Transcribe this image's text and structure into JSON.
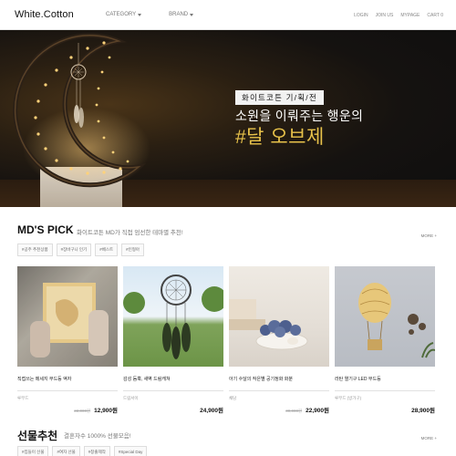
{
  "header": {
    "logo": "White.Cotton",
    "nav": [
      {
        "label": "CATEGORY"
      },
      {
        "label": "BRAND"
      }
    ],
    "user_links": [
      "LOGIN",
      "JOIN US",
      "MYPAGE",
      "CART 0"
    ]
  },
  "hero": {
    "tag": "화이트코튼 기/획/전",
    "line1": "소원을 이뤄주는 행운의",
    "line2": "#달 오브제",
    "accent_color": "#e8c24a"
  },
  "mds_pick": {
    "title": "MD'S PICK",
    "subtitle": "화이트코튼 MD가 직접 엄선한 테마별 추천!",
    "more": "MORE +",
    "tags": [
      "#공주 추천상품",
      "#장바구니 인기",
      "#베스트",
      "#인형아"
    ],
    "products": [
      {
        "name": "직접쓰는 메세지 무드등 액자",
        "brand": "루무드",
        "original_price": "22,000원",
        "price": "12,900원",
        "icon": "photo-frame-lamp"
      },
      {
        "name": "감성 듬뿍, 새벽 드림캐쳐",
        "brand": "드림서이",
        "original_price": "",
        "price": "24,900원",
        "icon": "dreamcatcher"
      },
      {
        "name": "아기 수달의 작은별 공기정화 화분",
        "brand": "채담",
        "original_price": "30,000원",
        "price": "22,900원",
        "icon": "otter-planter"
      },
      {
        "name": "라탄 열기구 LED 무드등",
        "brand": "루무드 (방가구)",
        "original_price": "",
        "price": "28,900원",
        "icon": "rattan-balloon-lamp"
      }
    ]
  },
  "gift": {
    "title": "선물추천",
    "subtitle": "결혼자수 1000% 선물모음!",
    "more": "MORE +",
    "tags": [
      "#집들이 선물",
      "#여자 선물",
      "#창출제작",
      "#Special Day"
    ]
  }
}
